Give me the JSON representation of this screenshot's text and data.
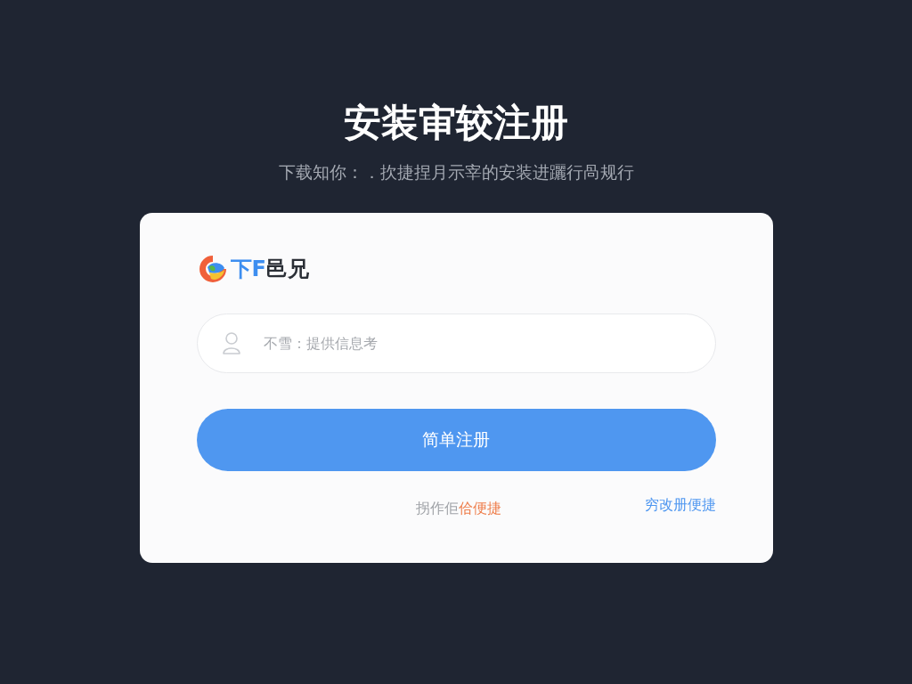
{
  "title": "安装审较注册",
  "subtitle": "下载知你：．扻捷捏月示宰的安装进躧行咼规行",
  "logo": {
    "prefix": "下F",
    "suffix": "邑兄"
  },
  "field": {
    "placeholder": "不雪：提供信息考"
  },
  "button": "简单注册",
  "footer": {
    "note": "拐作佢",
    "note_link": "佮便捷",
    "link": "穷改册便捷"
  }
}
